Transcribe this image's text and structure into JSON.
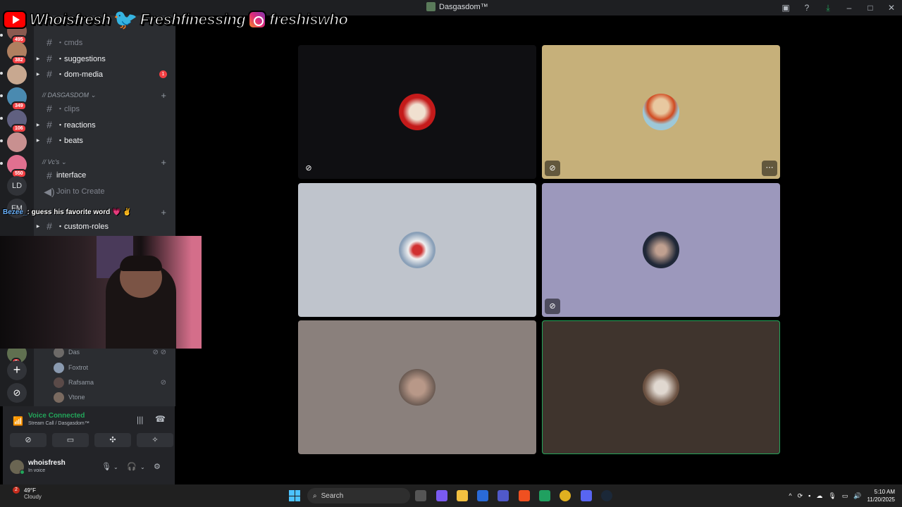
{
  "window": {
    "title": "Dasgasdom™"
  },
  "overlay": {
    "handles": [
      "Whoisfresh",
      "Freshfinessing",
      "freshiswho_"
    ],
    "chat": {
      "user": "Bezee_",
      "message": ": guess his favorite word 💗 ✌️"
    }
  },
  "servers": {
    "badges": [
      "495",
      "382",
      "349",
      "106",
      "550",
      "9"
    ],
    "text_icons": [
      "LD",
      "FM"
    ]
  },
  "sidebar": {
    "channels_top": [
      {
        "name": "・cmds",
        "unread": false,
        "mention": ""
      },
      {
        "name": "・suggestions",
        "unread": true,
        "mention": ""
      },
      {
        "name": "・dom-media",
        "unread": true,
        "mention": "1"
      }
    ],
    "category1": "// DASGASDOM",
    "channels_mid": [
      {
        "name": "・clips",
        "unread": false
      },
      {
        "name": "・reactions",
        "unread": true
      },
      {
        "name": "・beats",
        "unread": true
      }
    ],
    "category2": "// Vc's",
    "channel_interface": "interface",
    "channel_join": "Join to Create",
    "channel_roles": "・custom-roles",
    "voice_users": [
      "Das",
      "Foxtrot",
      "Rafsama",
      "Vtone"
    ]
  },
  "voice_panel": {
    "status": "Voice Connected",
    "channel": "Stream Call / Dasgasdom™"
  },
  "user": {
    "name": "whoisfresh",
    "status": "In voice"
  },
  "colors": {
    "tile1": "#0f0f12",
    "tile2": "#c6b07a",
    "tile3": "#bfc4cc",
    "tile4": "#9c98bc",
    "tile5": "#8a807c",
    "tile6": "#3f342d",
    "accent_green": "#23a55a"
  },
  "taskbar": {
    "weather_temp": "49°F",
    "weather_cond": "Cloudy",
    "weather_badge": "2",
    "search_placeholder": "Search",
    "time": "5:10 AM",
    "date": "11/20/2025"
  }
}
